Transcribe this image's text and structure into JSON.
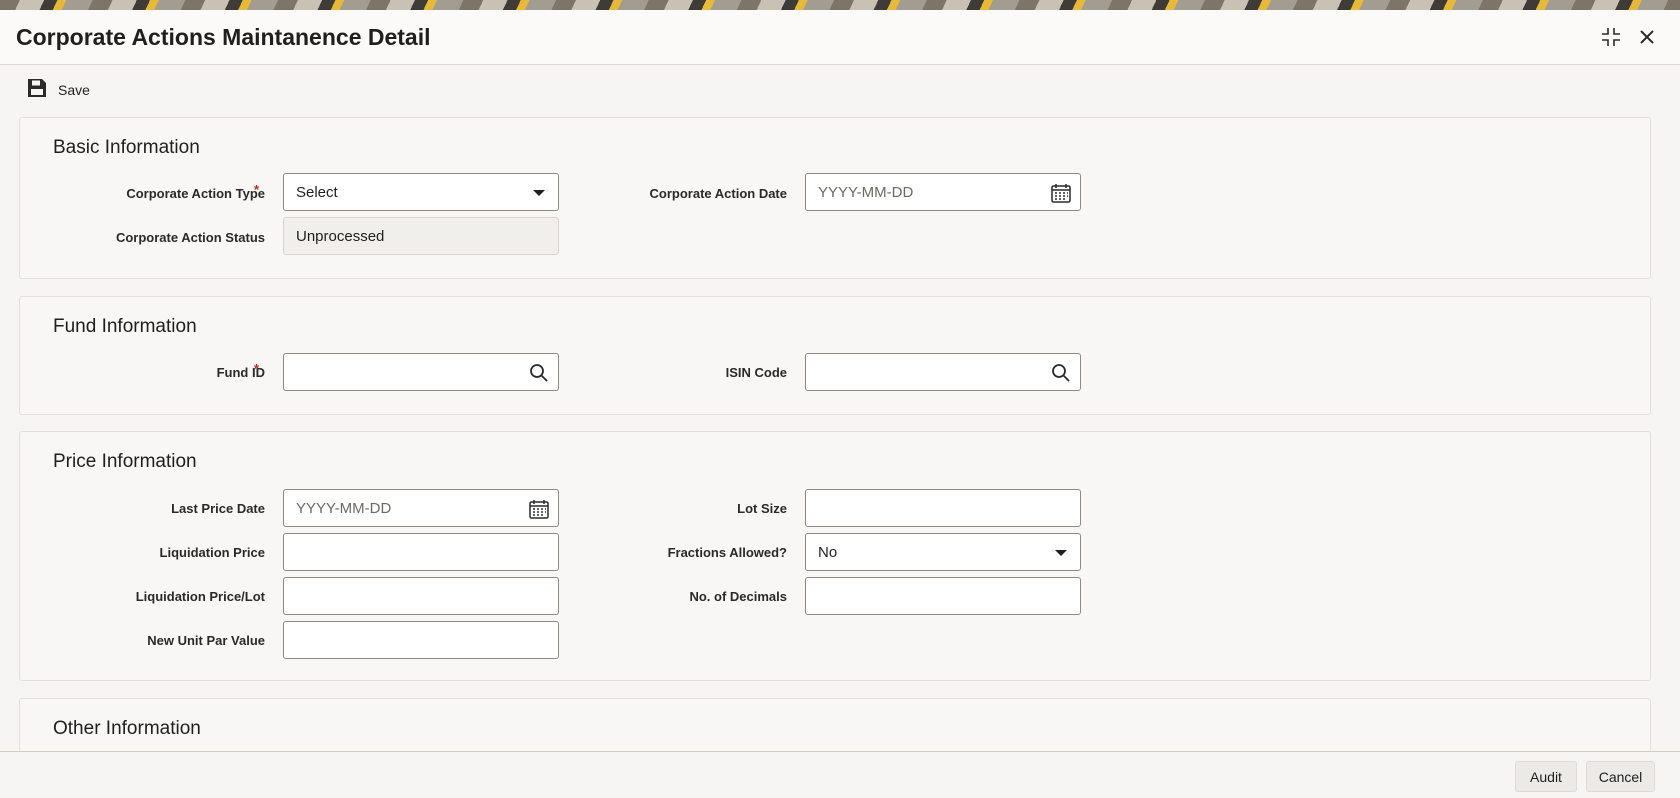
{
  "window": {
    "title": "Corporate Actions Maintanence Detail",
    "icons": [
      "collapse-icon",
      "close-icon"
    ]
  },
  "toolbar": {
    "save_label": "Save"
  },
  "basic_info": {
    "heading": "Basic Information",
    "corporate_action_type": {
      "label": "Corporate Action Type",
      "value": "Select",
      "required": true
    },
    "corporate_action_date": {
      "label": "Corporate Action Date",
      "placeholder": "YYYY-MM-DD"
    },
    "corporate_action_status": {
      "label": "Corporate Action Status",
      "value": "Unprocessed"
    }
  },
  "fund_info": {
    "heading": "Fund Information",
    "fund_id": {
      "label": "Fund ID",
      "value": "",
      "required": true
    },
    "isin_code": {
      "label": "ISIN Code",
      "value": ""
    }
  },
  "price_info": {
    "heading": "Price Information",
    "last_price_date": {
      "label": "Last Price Date",
      "placeholder": "YYYY-MM-DD"
    },
    "lot_size": {
      "label": "Lot Size",
      "value": ""
    },
    "liquidation_price": {
      "label": "Liquidation Price",
      "value": ""
    },
    "fractions_allowed": {
      "label": "Fractions Allowed?",
      "value": "No"
    },
    "liquidation_price_lot": {
      "label": "Liquidation Price/Lot",
      "value": ""
    },
    "no_of_decimals": {
      "label": "No. of Decimals",
      "value": ""
    },
    "new_unit_par_value": {
      "label": "New Unit Par Value",
      "value": ""
    }
  },
  "other_info": {
    "heading": "Other Information"
  },
  "footer": {
    "audit_label": "Audit",
    "cancel_label": "Cancel"
  },
  "colors": {
    "required": "#c0281e",
    "panel_bg": "#f8f7f5",
    "page_bg": "#f6f5f3"
  }
}
